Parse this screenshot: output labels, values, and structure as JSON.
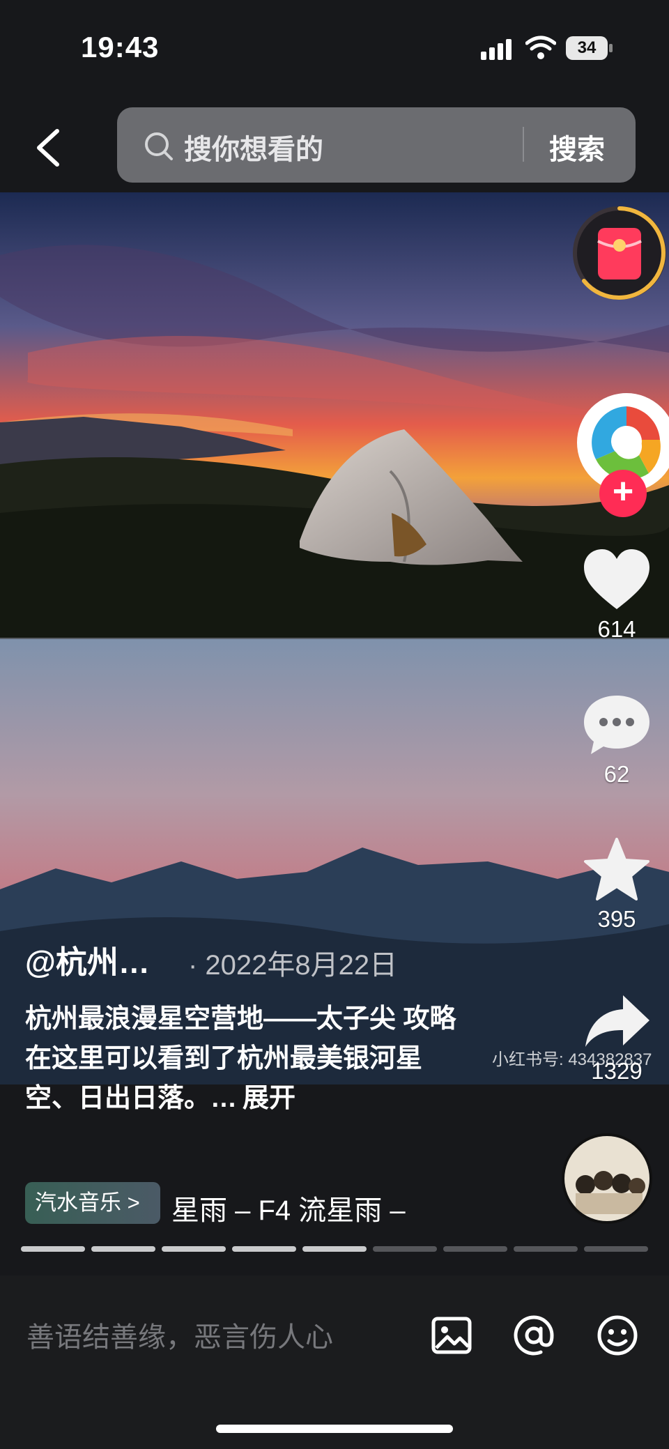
{
  "status_bar": {
    "time": "19:43",
    "battery": "34",
    "icons": [
      "signal-icon",
      "wifi-icon",
      "battery-icon"
    ]
  },
  "header": {
    "back_icon": "back-arrow-icon",
    "search_placeholder": "搜你想看的",
    "search_button": "搜索",
    "search_icon": "search-icon"
  },
  "right_rail": {
    "red_packet_icon": "red-packet-icon",
    "author_avatar_icon": "author-avatar-icon",
    "follow_icon": "plus-icon",
    "follow_symbol": "+",
    "like": {
      "icon": "heart-icon",
      "count": "614"
    },
    "comment": {
      "icon": "comment-icon",
      "count": "62"
    },
    "favorite": {
      "icon": "star-icon",
      "count": "395"
    },
    "share": {
      "icon": "share-icon",
      "count": "1329"
    }
  },
  "watermark": "小红书号: 434382837",
  "post": {
    "author": "@杭州…",
    "date": "· 2022年8月22日",
    "description": "杭州最浪漫星空营地——太子尖 攻略在这里可以看到了杭州最美银河星空、日出日落。…",
    "expand_label": "展开"
  },
  "music": {
    "tag": "汽水音乐 >",
    "track": "星雨 – F4    流星雨 –"
  },
  "progress": {
    "segments": 9,
    "completed": 5
  },
  "comment_bar": {
    "placeholder": "善语结善缘，恶言伤人心",
    "icons": [
      "image-icon",
      "at-icon",
      "emoji-icon"
    ]
  },
  "colors": {
    "accent": "#ff2c55",
    "packet_ring": "#f1b63e",
    "background": "#17181b"
  }
}
